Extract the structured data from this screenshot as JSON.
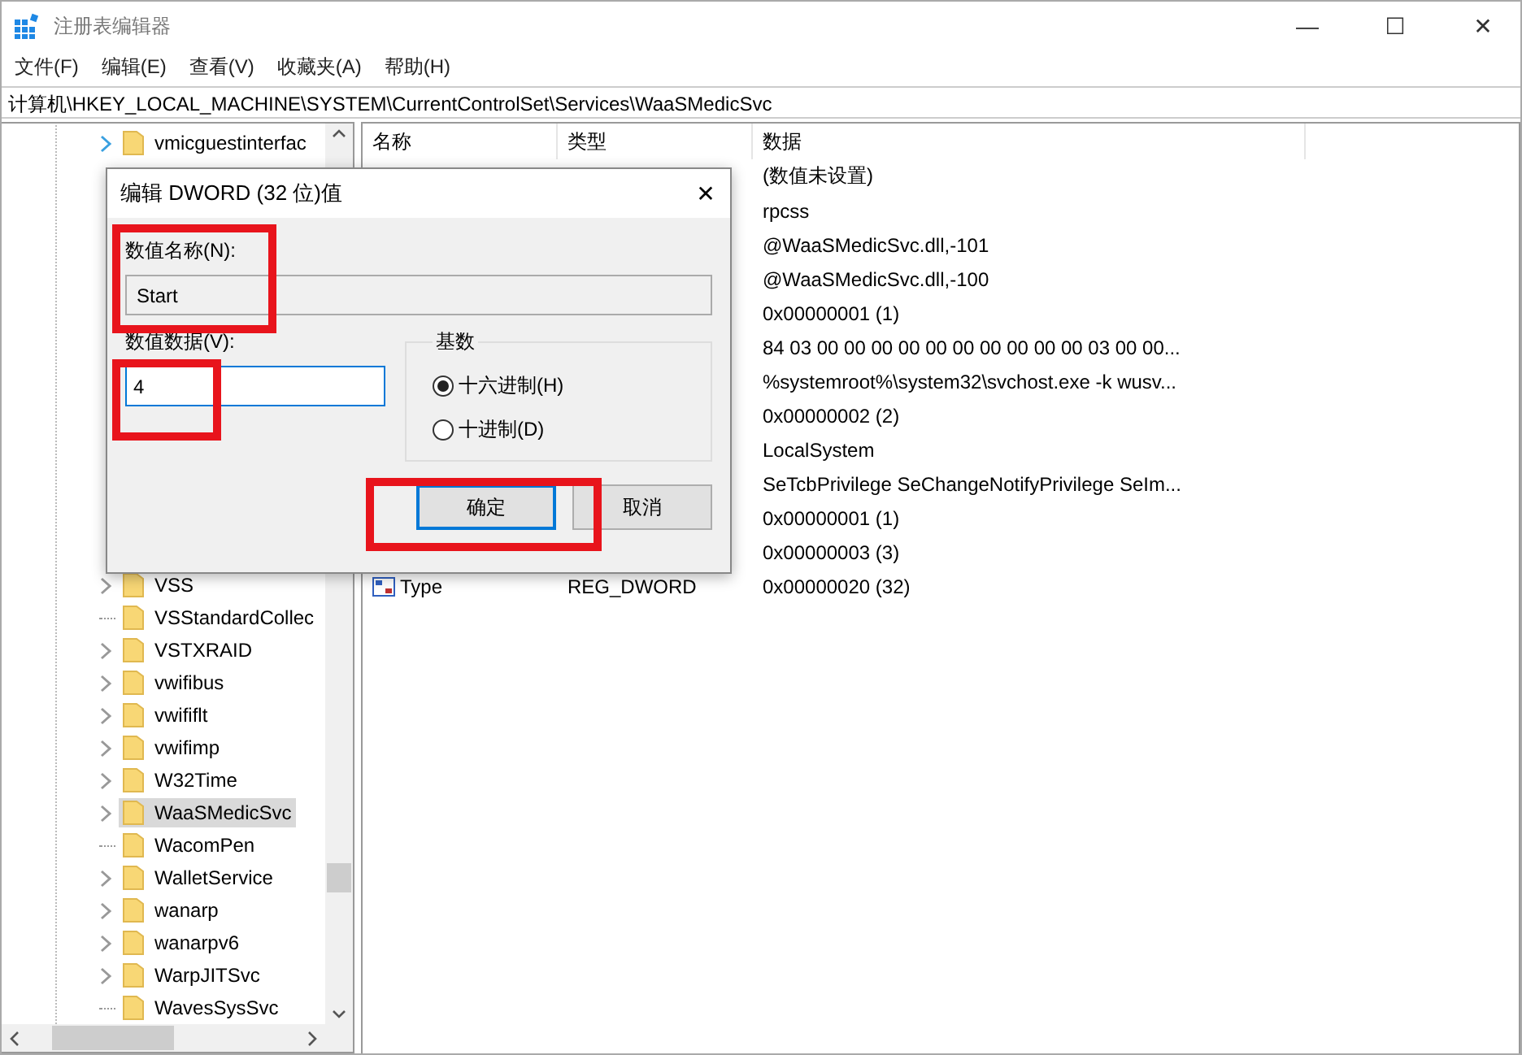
{
  "window": {
    "title": "注册表编辑器",
    "controls": [
      "—",
      "☐",
      "✕"
    ]
  },
  "menu": [
    "文件(F)",
    "编辑(E)",
    "查看(V)",
    "收藏夹(A)",
    "帮助(H)"
  ],
  "address": "计算机\\HKEY_LOCAL_MACHINE\\SYSTEM\\CurrentControlSet\\Services\\WaaSMedicSvc",
  "tree": {
    "top_items": [
      {
        "label": "vmicguestinterfac",
        "has_children": true,
        "selected": false
      }
    ],
    "items": [
      {
        "label": "VSS",
        "has_children": true,
        "selected": false
      },
      {
        "label": "VSStandardCollec",
        "has_children": false,
        "selected": false
      },
      {
        "label": "VSTXRAID",
        "has_children": true,
        "selected": false
      },
      {
        "label": "vwifibus",
        "has_children": true,
        "selected": false
      },
      {
        "label": "vwififlt",
        "has_children": true,
        "selected": false
      },
      {
        "label": "vwifimp",
        "has_children": true,
        "selected": false
      },
      {
        "label": "W32Time",
        "has_children": true,
        "selected": false
      },
      {
        "label": "WaaSMedicSvc",
        "has_children": true,
        "selected": true
      },
      {
        "label": "WacomPen",
        "has_children": false,
        "selected": false
      },
      {
        "label": "WalletService",
        "has_children": true,
        "selected": false
      },
      {
        "label": "wanarp",
        "has_children": true,
        "selected": false
      },
      {
        "label": "wanarpv6",
        "has_children": true,
        "selected": false
      },
      {
        "label": "WarpJITSvc",
        "has_children": true,
        "selected": false
      },
      {
        "label": "WavesSysSvc",
        "has_children": false,
        "selected": false
      }
    ]
  },
  "values": {
    "columns": [
      "名称",
      "类型",
      "数据"
    ],
    "rows": [
      {
        "data": "(数值未设置)"
      },
      {
        "data": "rpcss"
      },
      {
        "data": "@WaaSMedicSvc.dll,-101"
      },
      {
        "data": "@WaaSMedicSvc.dll,-100"
      },
      {
        "data": "0x00000001 (1)"
      },
      {
        "data": "84 03 00 00 00 00 00 00 00 00 00 00 03 00 00..."
      },
      {
        "data": "%systemroot%\\system32\\svchost.exe -k wusv..."
      },
      {
        "data": "0x00000002 (2)"
      },
      {
        "data": "LocalSystem"
      },
      {
        "data": "SeTcbPrivilege SeChangeNotifyPrivilege SeIm..."
      },
      {
        "data": "0x00000001 (1)"
      },
      {
        "data": "0x00000003 (3)"
      },
      {
        "name": "Type",
        "type": "REG_DWORD",
        "data": "0x00000020 (32)"
      }
    ]
  },
  "dialog": {
    "title": "编辑 DWORD (32 位)值",
    "close": "✕",
    "name_label": "数值名称(N):",
    "name_value": "Start",
    "data_label": "数值数据(V):",
    "data_value": "4",
    "base_label": "基数",
    "bases": [
      {
        "label": "十六进制(H)",
        "selected": true
      },
      {
        "label": "十进制(D)",
        "selected": false
      }
    ],
    "buttons": [
      {
        "label": "确定",
        "default": true
      },
      {
        "label": "取消",
        "default": false
      }
    ]
  }
}
